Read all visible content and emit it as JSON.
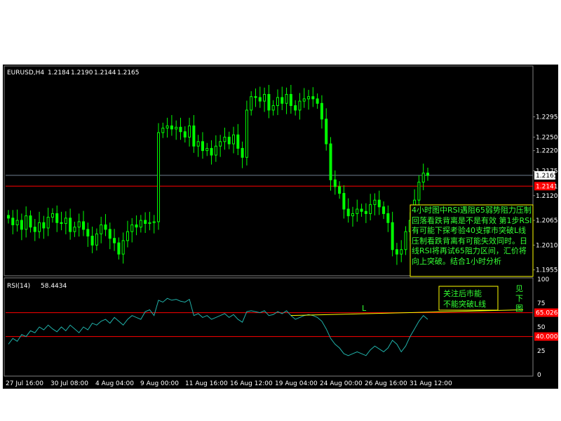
{
  "chart_data": [
    {
      "type": "candlestick",
      "title": "EURUSD,H4",
      "ohlc_header": [
        "1.2184",
        "1.2190",
        "1.2144",
        "1.2165"
      ],
      "ylim": [
        1.1945,
        1.2405
      ],
      "y_ticks": [
        "1.2295",
        "1.2250",
        "1.2220",
        "1.2175",
        "1.2120",
        "1.2065",
        "1.2010",
        "1.1955"
      ],
      "y_tick_values": [
        1.2295,
        1.225,
        1.222,
        1.2175,
        1.212,
        1.2065,
        1.201,
        1.1955
      ],
      "current_price_label": "1.2165",
      "current_price": 1.2165,
      "resistance_line_label": "1.2141",
      "resistance_line": 1.2141,
      "bars_close": [
        1.207,
        1.2055,
        1.2065,
        1.2045,
        1.2075,
        1.205,
        1.204,
        1.206,
        1.2048,
        1.2072,
        1.208,
        1.206,
        1.2058,
        1.207,
        1.204,
        1.205,
        1.2062,
        1.2045,
        1.203,
        1.201,
        1.2035,
        1.2055,
        1.2045,
        1.2025,
        1.2015,
        1.199,
        1.202,
        1.204,
        1.2055,
        1.205,
        1.2065,
        1.2058,
        1.206,
        1.2062,
        1.226,
        1.227,
        1.2275,
        1.2268,
        1.2272,
        1.2262,
        1.225,
        1.2275,
        1.223,
        1.224,
        1.222,
        1.2225,
        1.221,
        1.223,
        1.224,
        1.225,
        1.2235,
        1.2255,
        1.2225,
        1.2205,
        1.231,
        1.234,
        1.2338,
        1.233,
        1.2345,
        1.231,
        1.232,
        1.2338,
        1.2325,
        1.2345,
        1.232,
        1.231,
        1.233,
        1.2335,
        1.234,
        1.2335,
        1.2325,
        1.229,
        1.2235,
        1.2155,
        1.214,
        1.2125,
        1.209,
        1.2075,
        1.208,
        1.209,
        1.2085,
        1.208,
        1.21,
        1.211,
        1.2095,
        1.208,
        1.206,
        1.2,
        1.199,
        1.2,
        1.204,
        1.2065,
        1.211,
        1.215,
        1.217,
        1.2165
      ],
      "annotation": "4小时图中RSI遇阻65弱势阻力压制回落看跌背离是不是有效 第1步RSI有可能下探考验40支撑市突破L线压制看跌背离有可能失效同时。日线RSI将再试65阻力区间，汇价将向上突破。结合1小时分析"
    },
    {
      "type": "line",
      "title": "RSI(14)",
      "value_header": "58.4434",
      "ylim": [
        0,
        100
      ],
      "y_ticks": [
        "100",
        "75",
        "50",
        "25",
        "0"
      ],
      "y_tick_values": [
        100,
        75,
        50,
        25,
        0
      ],
      "level_lines": [
        {
          "label": "65.0265",
          "value": 65.0265
        },
        {
          "label": "40.0000",
          "value": 40.0
        }
      ],
      "series": [
        {
          "values": [
            32,
            38,
            35,
            42,
            40,
            46,
            44,
            50,
            47,
            52,
            48,
            45,
            50,
            46,
            52,
            48,
            44,
            50,
            47,
            54,
            52,
            56,
            58,
            54,
            60,
            56,
            52,
            58,
            62,
            60,
            58,
            66,
            68,
            62,
            78,
            76,
            80,
            78,
            79,
            77,
            76,
            79,
            62,
            64,
            60,
            62,
            58,
            60,
            62,
            64,
            60,
            63,
            58,
            55,
            66,
            67,
            66,
            65,
            67,
            62,
            63,
            66,
            64,
            67,
            62,
            58,
            60,
            62,
            63,
            62,
            60,
            56,
            48,
            38,
            32,
            28,
            22,
            20,
            22,
            24,
            22,
            20,
            26,
            30,
            27,
            24,
            28,
            36,
            32,
            24,
            30,
            40,
            48,
            56,
            62,
            58
          ]
        }
      ],
      "trend_line_label": "L",
      "callout_text": [
        "关注后市能",
        "不能突破L线"
      ],
      "side_note": [
        "见",
        "下",
        "图"
      ]
    }
  ],
  "x_ticks": [
    "27 Jul 16:00",
    "30 Jul 08:00",
    "4 Aug 04:00",
    "9 Aug 00:00",
    "11 Aug 16:00",
    "16 Aug 12:00",
    "19 Aug 04:00",
    "24 Aug 00:00",
    "26 Aug 16:00",
    "31 Aug 12:00"
  ],
  "colors": {
    "background": "#000000",
    "candles": "#00ff00",
    "resistance": "#ff0000",
    "price_line": "#708090",
    "rsi_line": "#20b2aa",
    "trend_line": "#ffff00",
    "annotation_border": "#ffff00",
    "annotation_text": "#33ff33"
  }
}
